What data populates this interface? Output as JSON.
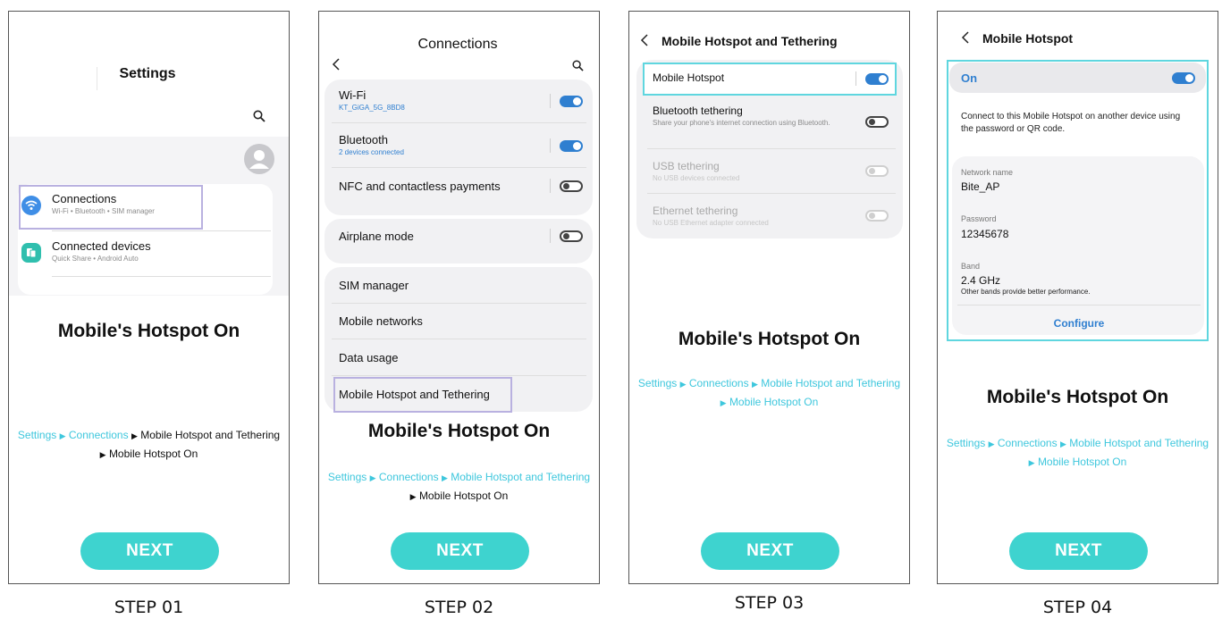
{
  "headline": "Mobile's Hotspot On",
  "next_label": "NEXT",
  "breadcrumb": {
    "settings": "Settings",
    "connections": "Connections",
    "hotspot_tethering": "Mobile Hotspot and Tethering",
    "hotspot_on": "Mobile Hotspot On"
  },
  "steps": [
    "STEP 01",
    "STEP 02",
    "STEP 03",
    "STEP 04"
  ],
  "step1": {
    "title": "Settings",
    "items": [
      {
        "title": "Connections",
        "sub": "Wi-Fi • Bluetooth • SIM manager"
      },
      {
        "title": "Connected devices",
        "sub": "Quick Share • Android Auto"
      }
    ]
  },
  "step2": {
    "title": "Connections",
    "wifi": {
      "title": "Wi-Fi",
      "sub": "KT_GiGA_5G_8BD8"
    },
    "bluetooth": {
      "title": "Bluetooth",
      "sub": "2 devices connected"
    },
    "nfc": {
      "title": "NFC and contactless payments"
    },
    "airplane": {
      "title": "Airplane mode"
    },
    "sim": "SIM manager",
    "mobile_networks": "Mobile networks",
    "data_usage": "Data usage",
    "hotspot": "Mobile Hotspot and Tethering"
  },
  "step3": {
    "title": "Mobile Hotspot and Tethering",
    "hotspot": "Mobile Hotspot",
    "bt": {
      "title": "Bluetooth tethering",
      "sub": "Share your phone's internet connection using Bluetooth."
    },
    "usb": {
      "title": "USB tethering",
      "sub": "No USB devices connected"
    },
    "eth": {
      "title": "Ethernet tethering",
      "sub": "No USB Ethernet adapter connected"
    }
  },
  "step4": {
    "title": "Mobile Hotspot",
    "on_label": "On",
    "desc": "Connect to this Mobile Hotspot on another device using the password or QR code.",
    "network_name_label": "Network name",
    "network_name": "Bite_AP",
    "password_label": "Password",
    "password": "12345678",
    "band_label": "Band",
    "band": "2.4 GHz",
    "band_note": "Other bands provide better performance.",
    "configure": "Configure"
  },
  "colors": {
    "accent_teal": "#3ed3cf",
    "crumb_cyan": "#3ec7dd",
    "toggle_blue": "#2f7fd0",
    "highlight_purple": "#b9b1e0",
    "highlight_teal": "#5fd6df"
  }
}
